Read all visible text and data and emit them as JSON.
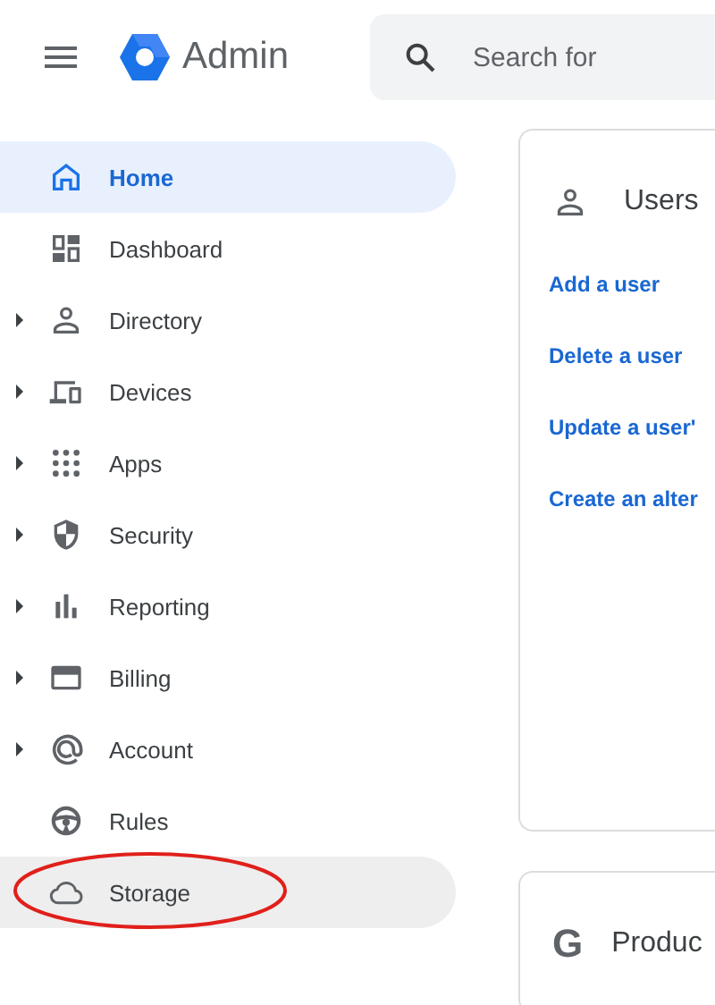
{
  "header": {
    "product": "Admin",
    "search": {
      "placeholder": "Search for"
    }
  },
  "sidebar": {
    "items": [
      {
        "label": "Home",
        "kind": "home",
        "selected": true,
        "has_children": false,
        "hovered": false,
        "circled": false
      },
      {
        "label": "Dashboard",
        "kind": "dashboard",
        "selected": false,
        "has_children": false,
        "hovered": false,
        "circled": false
      },
      {
        "label": "Directory",
        "kind": "person",
        "selected": false,
        "has_children": true,
        "hovered": false,
        "circled": false
      },
      {
        "label": "Devices",
        "kind": "devices",
        "selected": false,
        "has_children": true,
        "hovered": false,
        "circled": false
      },
      {
        "label": "Apps",
        "kind": "apps",
        "selected": false,
        "has_children": true,
        "hovered": false,
        "circled": false
      },
      {
        "label": "Security",
        "kind": "shield",
        "selected": false,
        "has_children": true,
        "hovered": false,
        "circled": false
      },
      {
        "label": "Reporting",
        "kind": "bars",
        "selected": false,
        "has_children": true,
        "hovered": false,
        "circled": false
      },
      {
        "label": "Billing",
        "kind": "card",
        "selected": false,
        "has_children": true,
        "hovered": false,
        "circled": false
      },
      {
        "label": "Account",
        "kind": "at",
        "selected": false,
        "has_children": true,
        "hovered": false,
        "circled": false
      },
      {
        "label": "Rules",
        "kind": "wheel",
        "selected": false,
        "has_children": false,
        "hovered": false,
        "circled": false
      },
      {
        "label": "Storage",
        "kind": "cloud",
        "selected": false,
        "has_children": false,
        "hovered": true,
        "circled": true
      }
    ]
  },
  "cards": [
    {
      "kind": "users",
      "title": "Users",
      "links": [
        "Add a user",
        "Delete a user",
        "Update a user'",
        "Create an alter"
      ]
    },
    {
      "kind": "product",
      "logo": "G",
      "title": "Produc"
    }
  ]
}
